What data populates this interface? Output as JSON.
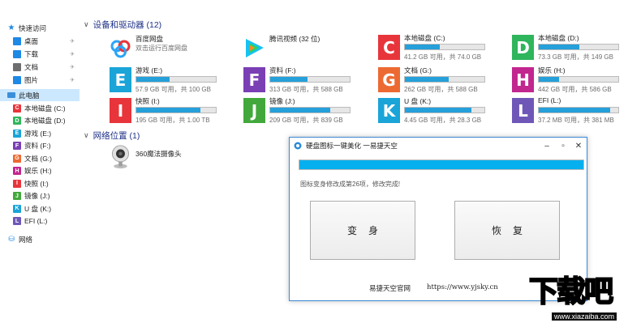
{
  "nav": {
    "quick_access": "快速访问",
    "quick_items": [
      {
        "label": "桌面",
        "icon": "desktop-icon",
        "color": "#1e88e5"
      },
      {
        "label": "下载",
        "icon": "download-icon",
        "color": "#1e88e5"
      },
      {
        "label": "文档",
        "icon": "document-icon",
        "color": "#6d6d6d"
      },
      {
        "label": "图片",
        "icon": "picture-icon",
        "color": "#1e88e5"
      }
    ],
    "this_pc": "此电脑",
    "drives": [
      {
        "label": "本地磁盘 (C:)",
        "letter": "C",
        "color": "#e8353b"
      },
      {
        "label": "本地磁盘 (D:)",
        "letter": "D",
        "color": "#2fb55c"
      },
      {
        "label": "游戏 (E:)",
        "letter": "E",
        "color": "#1aa4d8"
      },
      {
        "label": "资料 (F:)",
        "letter": "F",
        "color": "#7a3fb5"
      },
      {
        "label": "文档 (G:)",
        "letter": "G",
        "color": "#ec6a32"
      },
      {
        "label": "娱乐 (H:)",
        "letter": "H",
        "color": "#c2268f"
      },
      {
        "label": "快照 (I:)",
        "letter": "I",
        "color": "#e8353b"
      },
      {
        "label": "镜像 (J:)",
        "letter": "J",
        "color": "#43a83c"
      },
      {
        "label": "U 盘 (K:)",
        "letter": "K",
        "color": "#1aa4d8"
      },
      {
        "label": "EFI (L:)",
        "letter": "L",
        "color": "#6f57b8"
      }
    ],
    "network": "网络"
  },
  "main": {
    "devices_header": "设备和驱动器 (12)",
    "network_header": "网络位置 (1)",
    "apps": [
      {
        "name": "百度网盘",
        "sub": "双击运行百度网盘",
        "icon": "baidu-netdisk-icon"
      },
      {
        "name": "腾讯视频 (32 位)",
        "sub": "",
        "icon": "tencent-video-icon"
      }
    ],
    "drives": [
      {
        "name": "本地磁盘 (C:)",
        "letter": "C",
        "color": "#e8353b",
        "info": "41.2 GB 可用，共 74.0 GB",
        "used": 0.44
      },
      {
        "name": "本地磁盘 (D:)",
        "letter": "D",
        "color": "#2fb55c",
        "info": "73.3 GB 可用，共 149 GB",
        "used": 0.51
      },
      {
        "name": "游戏 (E:)",
        "letter": "E",
        "color": "#1aa4d8",
        "info": "57.9 GB 可用，共 100 GB",
        "used": 0.42
      },
      {
        "name": "资料 (F:)",
        "letter": "F",
        "color": "#7a3fb5",
        "info": "313 GB 可用，共 588 GB",
        "used": 0.47
      },
      {
        "name": "文档 (G:)",
        "letter": "G",
        "color": "#ec6a32",
        "info": "262 GB 可用，共 588 GB",
        "used": 0.55
      },
      {
        "name": "娱乐 (H:)",
        "letter": "H",
        "color": "#c2268f",
        "info": "442 GB 可用，共 586 GB",
        "used": 0.25
      },
      {
        "name": "快照 (I:)",
        "letter": "I",
        "color": "#e8353b",
        "info": "195 GB 可用，共 1.00 TB",
        "used": 0.81
      },
      {
        "name": "镜像 (J:)",
        "letter": "J",
        "color": "#43a83c",
        "info": "209 GB 可用，共 839 GB",
        "used": 0.75
      },
      {
        "name": "U 盘 (K:)",
        "letter": "K",
        "color": "#1aa4d8",
        "info": "4.45 GB 可用，共 28.3 GB",
        "used": 0.84
      },
      {
        "name": "EFI (L:)",
        "letter": "L",
        "color": "#6f57b8",
        "info": "37.2 MB 可用，共 381 MB",
        "used": 0.9
      }
    ],
    "camera": {
      "name": "360魔法摄像头",
      "icon": "webcam-icon"
    }
  },
  "dialog": {
    "title": "硬盘图标一键美化   一易捷天空",
    "progress": 1.0,
    "status": "图标变身修改成第26项，修改完成!",
    "transform_label": "变身",
    "restore_label": "恢复",
    "site_label": "易捷天空官网",
    "url": "https://www.yjsky.cn",
    "accent": "#3c8ad8",
    "progress_color": "#06b0ee"
  },
  "watermark": {
    "logo": "下载吧",
    "domain": "www.xiazaiba.com"
  }
}
